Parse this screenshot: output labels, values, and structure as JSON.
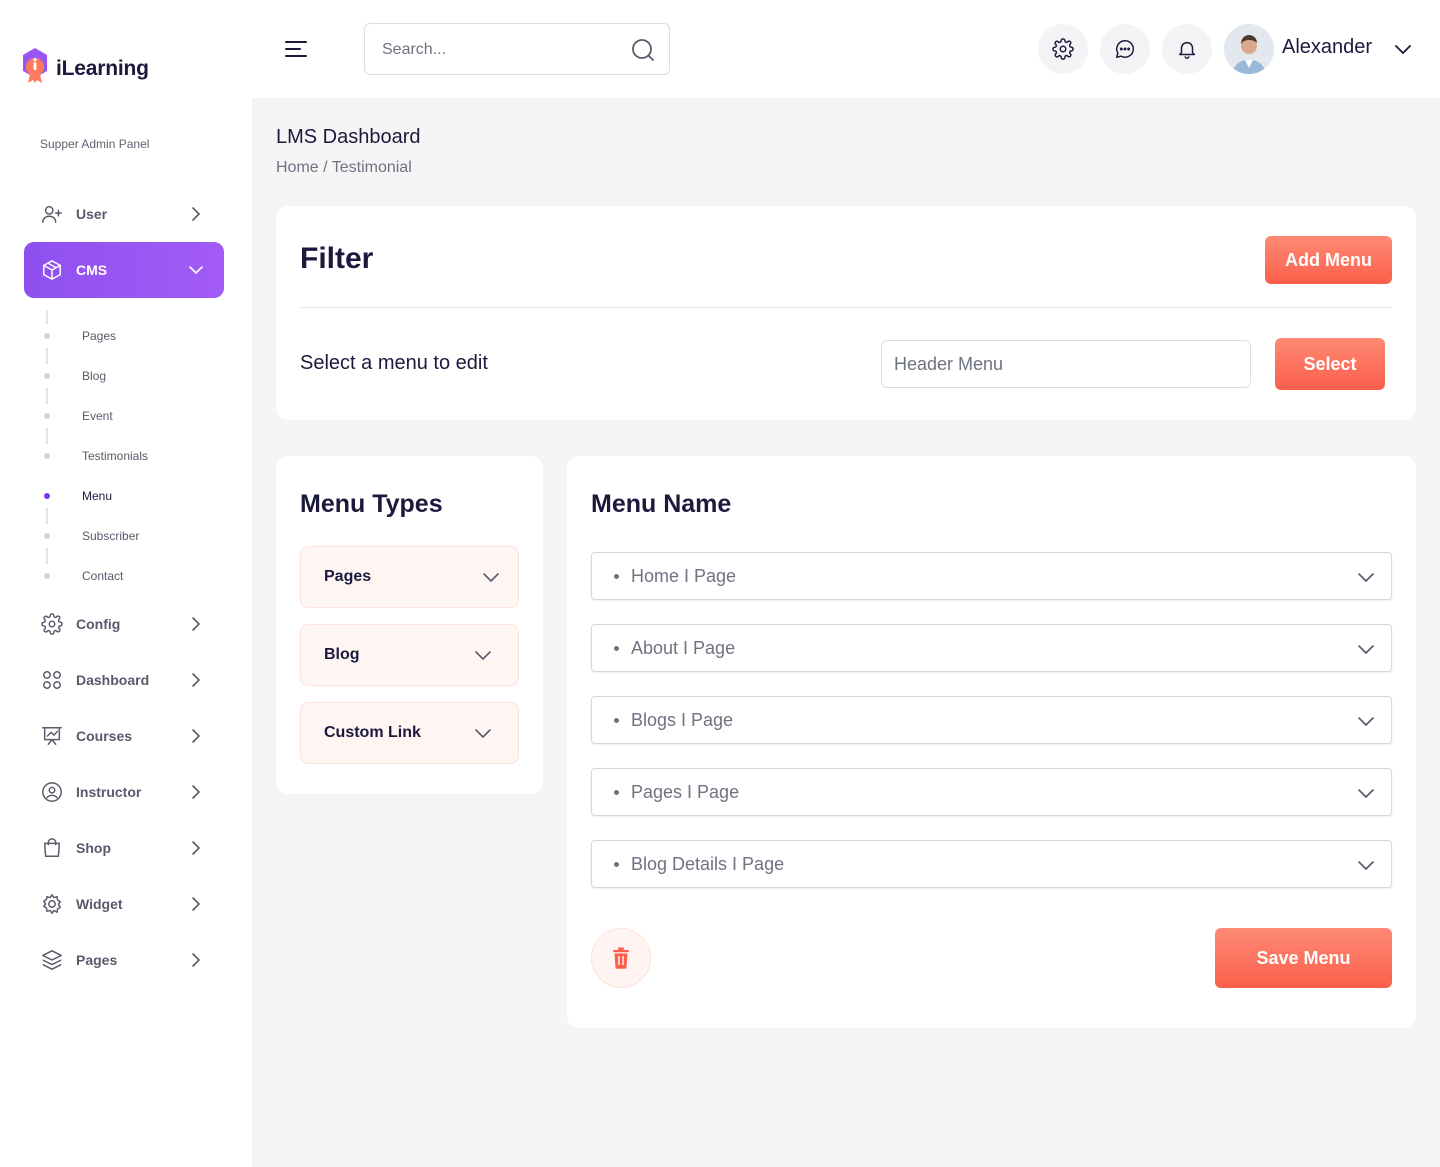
{
  "app": {
    "logo_text": "iLearning",
    "panel_label": "Supper Admin Panel"
  },
  "sidebar": {
    "items": [
      {
        "label": "User",
        "icon": "user-plus-icon"
      },
      {
        "label": "CMS",
        "icon": "box-icon"
      },
      {
        "label": "Config",
        "icon": "gear-icon"
      },
      {
        "label": "Dashboard",
        "icon": "grid-icon"
      },
      {
        "label": "Courses",
        "icon": "presentation-chart-icon"
      },
      {
        "label": "Instructor",
        "icon": "user-circle-icon"
      },
      {
        "label": "Shop",
        "icon": "shopping-bag-icon"
      },
      {
        "label": "Widget",
        "icon": "cog-wheel-icon"
      },
      {
        "label": "Pages",
        "icon": "layers-icon"
      }
    ],
    "cms_subitems": [
      "Pages",
      "Blog",
      "Event",
      "Testimonials",
      "Menu",
      "Subscriber",
      "Contact"
    ]
  },
  "header": {
    "search_placeholder": "Search...",
    "user_name": "Alexander"
  },
  "page": {
    "title": "LMS Dashboard",
    "breadcrumb": "Home / Testimonial"
  },
  "filter": {
    "title": "Filter",
    "add_button": "Add Menu",
    "select_label": "Select a menu to edit",
    "select_value": "Header Menu",
    "select_button": "Select"
  },
  "menu_types": {
    "title": "Menu Types",
    "items": [
      "Pages",
      "Blog",
      "Custom Link"
    ]
  },
  "menu_names": {
    "title": "Menu Name",
    "items": [
      "Home I Page",
      "About I Page",
      "Blogs I Page",
      "Pages I Page",
      "Blog Details I Page"
    ],
    "save_button": "Save Menu"
  },
  "colors": {
    "accent_purple": "#9a55f1",
    "accent_orange": "#fb5f4b",
    "text_dark": "#1b1a3d",
    "text_muted": "#6f7280"
  }
}
